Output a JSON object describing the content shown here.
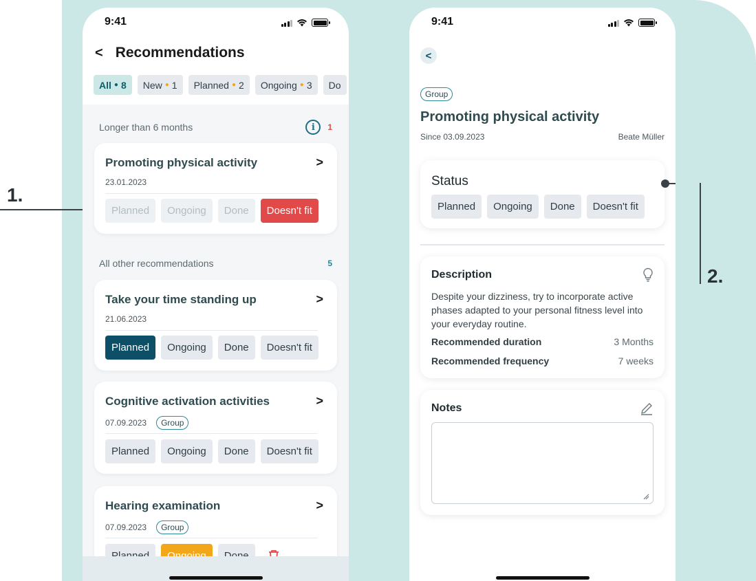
{
  "annotations": {
    "one": "1.",
    "two": "2."
  },
  "left_screen": {
    "time": "9:41",
    "title": "Recommendations",
    "filters": [
      {
        "label": "All",
        "count": "8"
      },
      {
        "label": "New",
        "count": "1"
      },
      {
        "label": "Planned",
        "count": "2"
      },
      {
        "label": "Ongoing",
        "count": "3"
      },
      {
        "label": "Do",
        "count": ""
      }
    ],
    "section_long": {
      "label": "Longer than 6 months",
      "count": "1"
    },
    "section_other": {
      "label": "All other recommendations",
      "count": "5"
    },
    "cards": [
      {
        "title": "Promoting physical activity",
        "date": "23.01.2023",
        "group": ""
      },
      {
        "title": "Take your time standing up",
        "date": "21.06.2023",
        "group": ""
      },
      {
        "title": "Cognitive activation activities",
        "date": "07.09.2023",
        "group": "Group"
      },
      {
        "title": "Hearing examination",
        "date": "07.09.2023",
        "group": "Group"
      }
    ],
    "status_labels": {
      "planned": "Planned",
      "ongoing": "Ongoing",
      "done": "Done",
      "doesnt_fit": "Doesn't fit"
    },
    "colors": {
      "accent": "#0d4f66",
      "danger": "#e24a4a",
      "warning": "#f2a71b",
      "chip_active": "#cce8e6"
    }
  },
  "right_screen": {
    "time": "9:41",
    "group": "Group",
    "title": "Promoting physical activity",
    "since": "Since 03.09.2023",
    "author": "Beate Müller",
    "status_title": "Status",
    "status_labels": {
      "planned": "Planned",
      "ongoing": "Ongoing",
      "done": "Done",
      "doesnt_fit": "Doesn't fit"
    },
    "description_title": "Description",
    "description": "Despite your dizziness, try to incorporate active phases adapted to your personal fitness level into your everyday routine.",
    "duration_label": "Recommended duration",
    "duration_value": "3 Months",
    "frequency_label": "Recommended frequency",
    "frequency_value": "7 weeks",
    "notes_title": "Notes",
    "notes_value": ""
  }
}
